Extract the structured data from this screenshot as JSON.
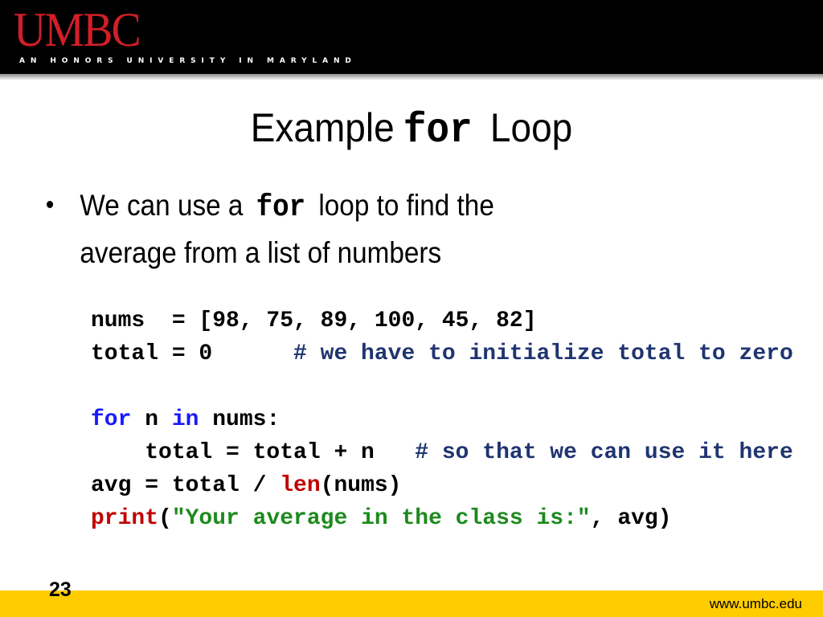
{
  "header": {
    "logo": "UMBC",
    "tagline": "AN HONORS UNIVERSITY IN MARYLAND"
  },
  "slide": {
    "title_prefix": "Example",
    "title_code": "for",
    "title_suffix": "Loop",
    "bullet": {
      "text_before": "We can use a",
      "code": "for",
      "text_after": "loop to find the",
      "line2": "average from a list of numbers"
    },
    "code_lines": [
      [
        {
          "t": "nums  = [98, 75, 89, 100, 45, 82]",
          "c": "plain"
        }
      ],
      [
        {
          "t": "total = 0      ",
          "c": "plain"
        },
        {
          "t": "# we have to initialize total to zero",
          "c": "cm"
        }
      ],
      [
        {
          "t": " ",
          "c": "plain"
        }
      ],
      [
        {
          "t": "for",
          "c": "kw"
        },
        {
          "t": " n ",
          "c": "plain"
        },
        {
          "t": "in",
          "c": "kw"
        },
        {
          "t": " nums:",
          "c": "plain"
        }
      ],
      [
        {
          "t": "    total = total + n   ",
          "c": "plain"
        },
        {
          "t": "# so that we can use it here",
          "c": "cm"
        }
      ],
      [
        {
          "t": "avg = total / ",
          "c": "plain"
        },
        {
          "t": "len",
          "c": "fn"
        },
        {
          "t": "(nums)",
          "c": "plain"
        }
      ],
      [
        {
          "t": "print",
          "c": "fn"
        },
        {
          "t": "(",
          "c": "plain"
        },
        {
          "t": "\"Your average in the class is:\"",
          "c": "str"
        },
        {
          "t": ", avg)",
          "c": "plain"
        }
      ]
    ]
  },
  "footer": {
    "page_number": "23",
    "url": "www.umbc.edu"
  },
  "colors": {
    "header_bg": "#000000",
    "logo": "#d01f28",
    "footer_bg": "#ffcc00",
    "keyword": "#1a1aff",
    "builtin": "#c00000",
    "string": "#1d8a1d",
    "comment": "#1f3470"
  }
}
